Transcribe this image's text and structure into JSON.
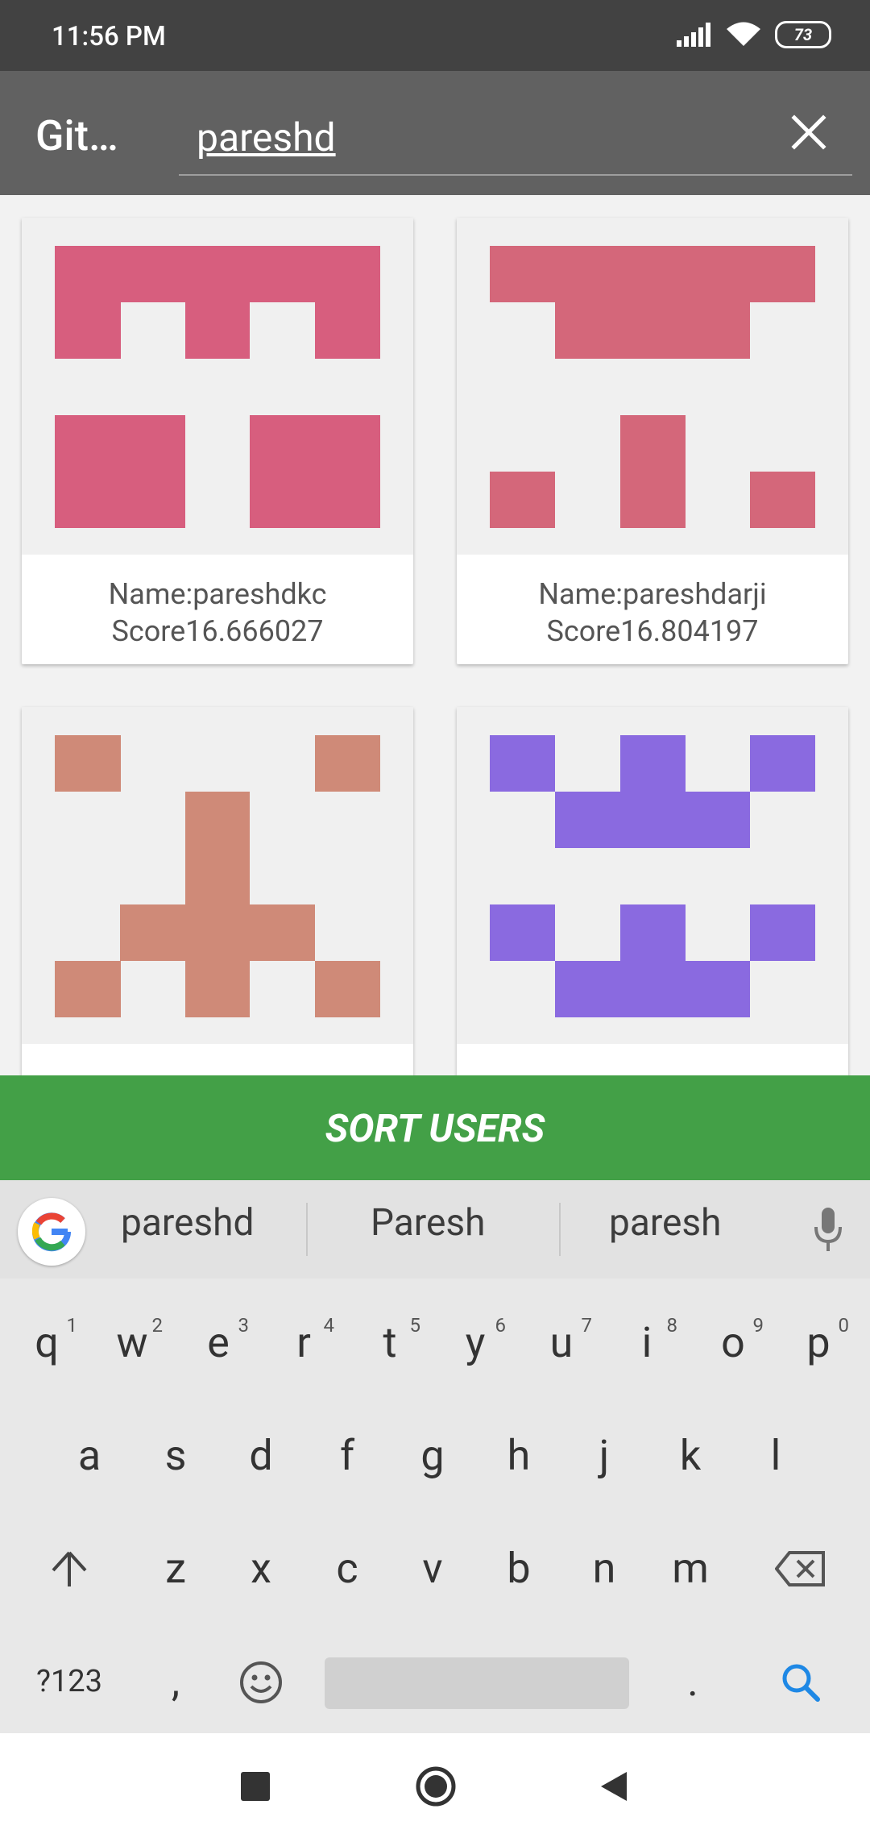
{
  "status": {
    "time": "11:56 PM",
    "battery": "73"
  },
  "appbar": {
    "title": "Git…",
    "query": "pareshd"
  },
  "cards": [
    {
      "name": "Name:pareshdkc",
      "score": "Score16.666027",
      "color": "#d75e7e"
    },
    {
      "name": "Name:pareshdarji",
      "score": "Score16.804197",
      "color": "#d4677a"
    },
    {
      "name": "",
      "score": "",
      "color": "#cf8a78"
    },
    {
      "name": "",
      "score": "",
      "color": "#8a6ae0"
    }
  ],
  "sort_button": {
    "label": "SORT USERS"
  },
  "keyboard": {
    "suggestions": [
      "pareshd",
      "Paresh",
      "paresh"
    ],
    "row1": [
      "q",
      "w",
      "e",
      "r",
      "t",
      "y",
      "u",
      "i",
      "o",
      "p"
    ],
    "row1_hints": [
      "1",
      "2",
      "3",
      "4",
      "5",
      "6",
      "7",
      "8",
      "9",
      "0"
    ],
    "row2": [
      "a",
      "s",
      "d",
      "f",
      "g",
      "h",
      "j",
      "k",
      "l"
    ],
    "row3": [
      "z",
      "x",
      "c",
      "v",
      "b",
      "n",
      "m"
    ],
    "mode_key": "?123",
    "comma": ",",
    "period": "."
  }
}
